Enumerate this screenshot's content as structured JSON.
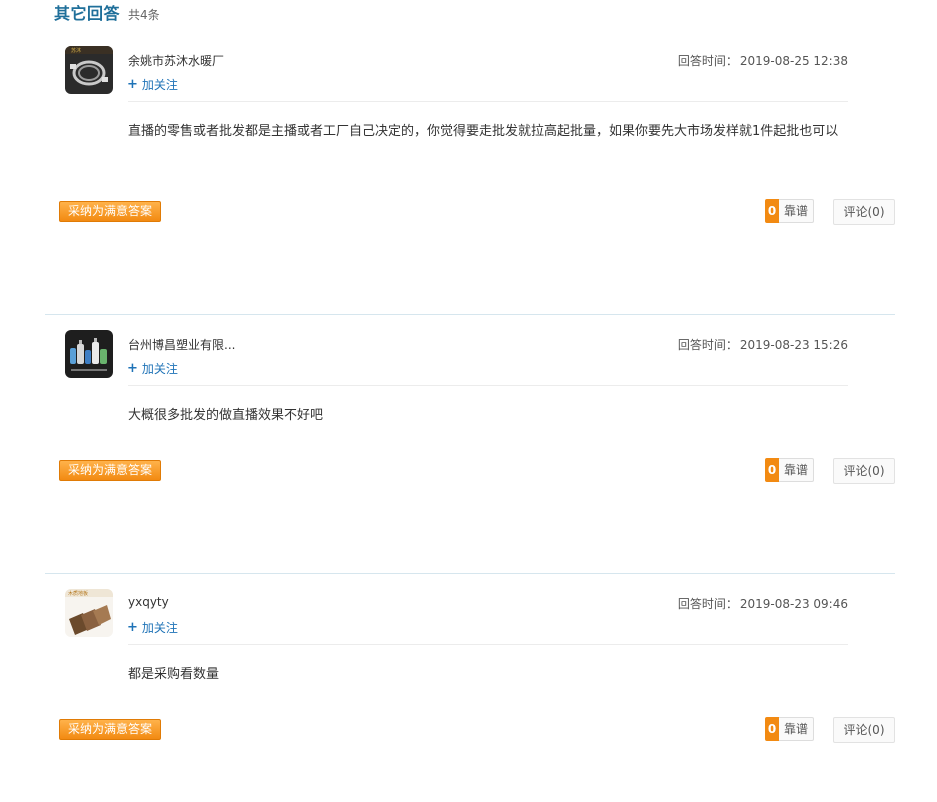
{
  "header": {
    "title": "其它回答",
    "count": "共4条"
  },
  "answers": [
    {
      "username": "余姚市苏沐水暖厂",
      "follow_label": "加关注",
      "time_label": "回答时间：",
      "time": "2019-08-25 12:38",
      "text": "直播的零售或者批发都是主播或者工厂自己决定的，你觉得要走批发就拉高起批量，如果你要先大市场发样就1件起批也可以",
      "accept_label": "采纳为满意答案",
      "vote_count": "0",
      "vote_label": "靠谱",
      "comment_label": "评论(0)",
      "avatar_icon": "metal-hose-product-icon"
    },
    {
      "username": "台州博昌塑业有限...",
      "follow_label": "加关注",
      "time_label": "回答时间：",
      "time": "2019-08-23 15:26",
      "text": "大概很多批发的做直播效果不好吧",
      "accept_label": "采纳为满意答案",
      "vote_count": "0",
      "vote_label": "靠谱",
      "comment_label": "评论(0)",
      "avatar_icon": "plastic-bottles-product-icon"
    },
    {
      "username": "yxqyty",
      "follow_label": "加关注",
      "time_label": "回答时间：",
      "time": "2019-08-23 09:46",
      "text": "都是采购看数量",
      "accept_label": "采纳为满意答案",
      "vote_count": "0",
      "vote_label": "靠谱",
      "comment_label": "评论(0)",
      "avatar_icon": "wood-flooring-product-icon"
    }
  ],
  "colors": {
    "title": "#1f6f9a",
    "link": "#1f73b7",
    "accent": "#f28a12",
    "divider": "#d6e6ee"
  }
}
